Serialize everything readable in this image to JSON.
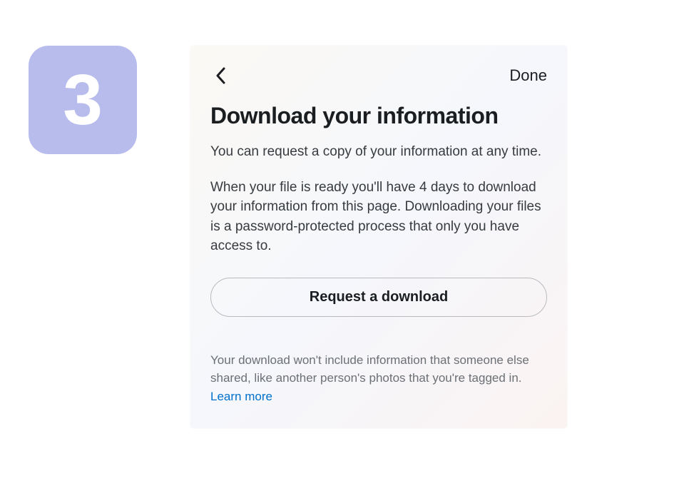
{
  "step": {
    "number": "3"
  },
  "header": {
    "done_label": "Done"
  },
  "title": "Download your information",
  "description_primary": "You can request a copy of your information at any time.",
  "description_secondary": "When your file is ready you'll have 4 days to download your information from this page. Downloading your files is a password-protected process that only you have access to.",
  "request_button_label": "Request a download",
  "disclaimer_text": "Your download won't include information that someone else shared, like another person's photos that you're tagged in. ",
  "learn_more_label": "Learn more"
}
